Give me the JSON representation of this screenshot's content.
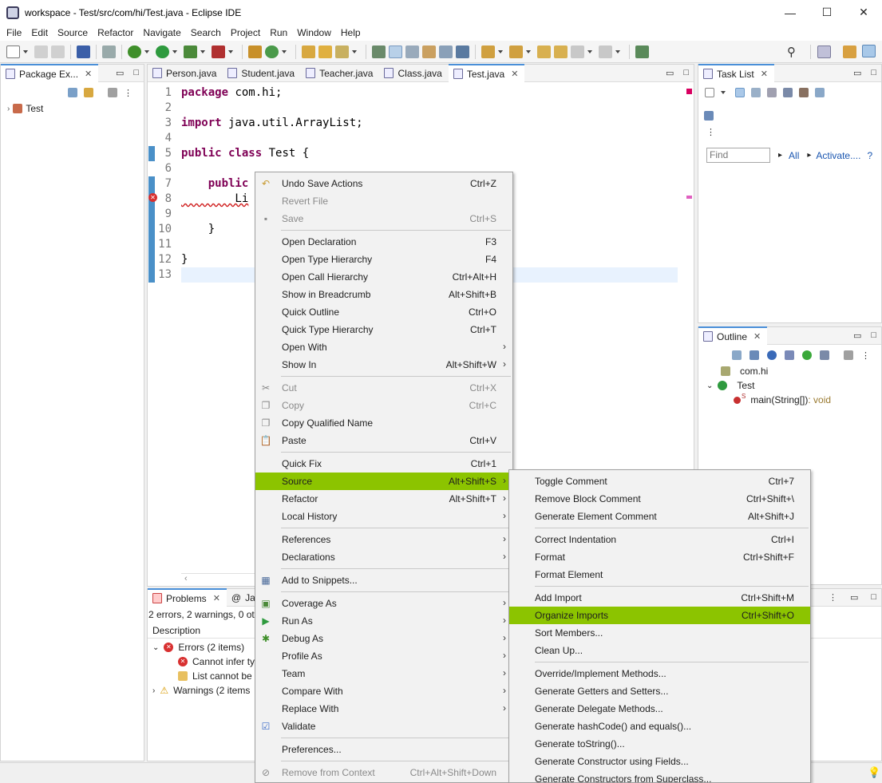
{
  "window": {
    "title": "workspace - Test/src/com/hi/Test.java - Eclipse IDE",
    "minimize": "—",
    "maximize": "☐",
    "close": "✕"
  },
  "menubar": [
    "File",
    "Edit",
    "Source",
    "Refactor",
    "Navigate",
    "Search",
    "Project",
    "Run",
    "Window",
    "Help"
  ],
  "package_explorer": {
    "tab": "Package Ex...",
    "close": "✕",
    "project": "Test"
  },
  "editor": {
    "tabs": [
      "Person.java",
      "Student.java",
      "Teacher.java",
      "Class.java",
      "Test.java"
    ],
    "active_tab": "Test.java",
    "close": "✕",
    "line_numbers": [
      "1",
      "2",
      "3",
      "4",
      "5",
      "6",
      "7",
      "8",
      "9",
      "10",
      "11",
      "12",
      "13"
    ],
    "code": [
      {
        "kw": "package",
        "rest": " com.hi;"
      },
      {
        "kw": "",
        "rest": ""
      },
      {
        "kw": "import",
        "rest": " java.util.ArrayList;"
      },
      {
        "kw": "",
        "rest": ""
      },
      {
        "kw": "public class",
        "rest": " Test {"
      },
      {
        "kw": "",
        "rest": ""
      },
      {
        "kw": "    public",
        "rest": ""
      },
      {
        "kw": "",
        "rest": "        Li"
      },
      {
        "kw": "",
        "rest": ""
      },
      {
        "kw": "",
        "rest": "    }"
      },
      {
        "kw": "",
        "rest": ""
      },
      {
        "kw": "",
        "rest": "}"
      },
      {
        "kw": "",
        "rest": ""
      }
    ]
  },
  "context_menu": {
    "items": [
      {
        "label": "Undo Save Actions",
        "accel": "Ctrl+Z",
        "icon": "undo-icon"
      },
      {
        "label": "Revert File",
        "accel": "",
        "disabled": true
      },
      {
        "label": "Save",
        "accel": "Ctrl+S",
        "disabled": true,
        "icon": "save-icon"
      },
      {
        "sep": true
      },
      {
        "label": "Open Declaration",
        "accel": "F3"
      },
      {
        "label": "Open Type Hierarchy",
        "accel": "F4"
      },
      {
        "label": "Open Call Hierarchy",
        "accel": "Ctrl+Alt+H"
      },
      {
        "label": "Show in Breadcrumb",
        "accel": "Alt+Shift+B"
      },
      {
        "label": "Quick Outline",
        "accel": "Ctrl+O"
      },
      {
        "label": "Quick Type Hierarchy",
        "accel": "Ctrl+T"
      },
      {
        "label": "Open With",
        "accel": "",
        "submenu": true
      },
      {
        "label": "Show In",
        "accel": "Alt+Shift+W",
        "submenu": true
      },
      {
        "sep": true
      },
      {
        "label": "Cut",
        "accel": "Ctrl+X",
        "disabled": true,
        "icon": "cut-icon"
      },
      {
        "label": "Copy",
        "accel": "Ctrl+C",
        "disabled": true,
        "icon": "copy-icon"
      },
      {
        "label": "Copy Qualified Name",
        "accel": "",
        "icon": "copy-qualified-icon"
      },
      {
        "label": "Paste",
        "accel": "Ctrl+V",
        "icon": "paste-icon"
      },
      {
        "sep": true
      },
      {
        "label": "Quick Fix",
        "accel": "Ctrl+1"
      },
      {
        "label": "Source",
        "accel": "Alt+Shift+S",
        "submenu": true,
        "highlighted": true
      },
      {
        "label": "Refactor",
        "accel": "Alt+Shift+T",
        "submenu": true
      },
      {
        "label": "Local History",
        "accel": "",
        "submenu": true
      },
      {
        "sep": true
      },
      {
        "label": "References",
        "accel": "",
        "submenu": true
      },
      {
        "label": "Declarations",
        "accel": "",
        "submenu": true
      },
      {
        "sep": true
      },
      {
        "label": "Add to Snippets...",
        "accel": "",
        "icon": "snippet-icon"
      },
      {
        "sep": true
      },
      {
        "label": "Coverage As",
        "accel": "",
        "submenu": true,
        "icon": "coverage-icon"
      },
      {
        "label": "Run As",
        "accel": "",
        "submenu": true,
        "icon": "run-icon"
      },
      {
        "label": "Debug As",
        "accel": "",
        "submenu": true,
        "icon": "debug-icon"
      },
      {
        "label": "Profile As",
        "accel": "",
        "submenu": true
      },
      {
        "label": "Team",
        "accel": "",
        "submenu": true
      },
      {
        "label": "Compare With",
        "accel": "",
        "submenu": true
      },
      {
        "label": "Replace With",
        "accel": "",
        "submenu": true
      },
      {
        "label": "Validate",
        "accel": "",
        "icon": "check-icon"
      },
      {
        "sep": true
      },
      {
        "label": "Preferences...",
        "accel": ""
      },
      {
        "sep": true
      },
      {
        "label": "Remove from Context",
        "accel": "Ctrl+Alt+Shift+Down",
        "disabled": true,
        "icon": "remove-context-icon"
      }
    ]
  },
  "source_submenu": {
    "items": [
      {
        "label": "Toggle Comment",
        "accel": "Ctrl+7"
      },
      {
        "label": "Remove Block Comment",
        "accel": "Ctrl+Shift+\\"
      },
      {
        "label": "Generate Element Comment",
        "accel": "Alt+Shift+J"
      },
      {
        "sep": true
      },
      {
        "label": "Correct Indentation",
        "accel": "Ctrl+I"
      },
      {
        "label": "Format",
        "accel": "Ctrl+Shift+F"
      },
      {
        "label": "Format Element",
        "accel": ""
      },
      {
        "sep": true
      },
      {
        "label": "Add Import",
        "accel": "Ctrl+Shift+M"
      },
      {
        "label": "Organize Imports",
        "accel": "Ctrl+Shift+O",
        "highlighted": true
      },
      {
        "label": "Sort Members...",
        "accel": ""
      },
      {
        "label": "Clean Up...",
        "accel": ""
      },
      {
        "sep": true
      },
      {
        "label": "Override/Implement Methods...",
        "accel": ""
      },
      {
        "label": "Generate Getters and Setters...",
        "accel": ""
      },
      {
        "label": "Generate Delegate Methods...",
        "accel": ""
      },
      {
        "label": "Generate hashCode() and equals()...",
        "accel": ""
      },
      {
        "label": "Generate toString()...",
        "accel": ""
      },
      {
        "label": "Generate Constructor using Fields...",
        "accel": ""
      },
      {
        "label": "Generate Constructors from Superclass...",
        "accel": ""
      }
    ]
  },
  "task_list": {
    "tab": "Task List",
    "close": "✕",
    "find_placeholder": "Find",
    "all": "All",
    "activate": "Activate....",
    "help": "?"
  },
  "outline": {
    "tab": "Outline",
    "close": "✕",
    "package": "com.hi",
    "class": "Test",
    "method": "main(String[])",
    "method_type": " : void",
    "static_marker": "S"
  },
  "problems": {
    "tab": "Problems",
    "second_tab": "Ja",
    "close": "✕",
    "summary": "2 errors, 2 warnings, 0 ot",
    "column": "Description",
    "errors": "Errors (2 items)",
    "error1": "Cannot infer ty",
    "error2": "List cannot be",
    "warnings": "Warnings (2 items"
  },
  "colors": {
    "highlight": "#8cc400",
    "keyword": "#7f0055",
    "accent": "#4a8fd8"
  }
}
